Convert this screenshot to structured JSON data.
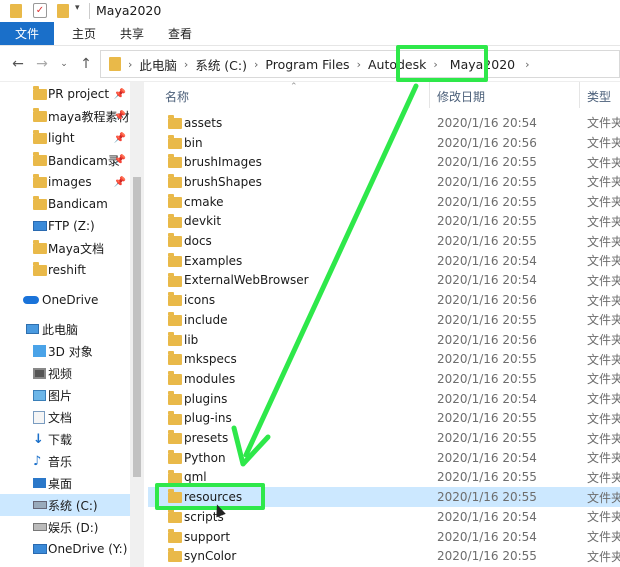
{
  "window": {
    "title": "Maya2020"
  },
  "ribbon": {
    "tabs": [
      "文件",
      "主页",
      "共享",
      "查看"
    ]
  },
  "address": {
    "crumbs": [
      "此电脑",
      "系统 (C:)",
      "Program Files",
      "Autodesk",
      "Maya2020"
    ]
  },
  "sidebar": {
    "quick": [
      {
        "label": "PR project",
        "pin": "📌"
      },
      {
        "label": "maya教程素材",
        "pin": "📌"
      },
      {
        "label": "light",
        "pin": "📌"
      },
      {
        "label": "Bandicam录",
        "pin": "📌"
      },
      {
        "label": "images",
        "pin": "📌"
      },
      {
        "label": "Bandicam"
      },
      {
        "label": "FTP (Z:)"
      },
      {
        "label": "Maya文档"
      },
      {
        "label": "reshift"
      }
    ],
    "onedrive": "OneDrive",
    "thispc": "此电脑",
    "pc_items": [
      "3D 对象",
      "视频",
      "图片",
      "文档",
      "下载",
      "音乐",
      "桌面",
      "系统 (C:)",
      "娱乐 (D:)",
      "OneDrive (Y:)"
    ]
  },
  "columns": {
    "name": "名称",
    "date": "修改日期",
    "type": "类型"
  },
  "files": [
    {
      "name": "assets",
      "date": "2020/1/16 20:54",
      "type": "文件夹"
    },
    {
      "name": "bin",
      "date": "2020/1/16 20:56",
      "type": "文件夹"
    },
    {
      "name": "brushImages",
      "date": "2020/1/16 20:55",
      "type": "文件夹"
    },
    {
      "name": "brushShapes",
      "date": "2020/1/16 20:55",
      "type": "文件夹"
    },
    {
      "name": "cmake",
      "date": "2020/1/16 20:55",
      "type": "文件夹"
    },
    {
      "name": "devkit",
      "date": "2020/1/16 20:55",
      "type": "文件夹"
    },
    {
      "name": "docs",
      "date": "2020/1/16 20:55",
      "type": "文件夹"
    },
    {
      "name": "Examples",
      "date": "2020/1/16 20:54",
      "type": "文件夹"
    },
    {
      "name": "ExternalWebBrowser",
      "date": "2020/1/16 20:54",
      "type": "文件夹"
    },
    {
      "name": "icons",
      "date": "2020/1/16 20:56",
      "type": "文件夹"
    },
    {
      "name": "include",
      "date": "2020/1/16 20:55",
      "type": "文件夹"
    },
    {
      "name": "lib",
      "date": "2020/1/16 20:56",
      "type": "文件夹"
    },
    {
      "name": "mkspecs",
      "date": "2020/1/16 20:55",
      "type": "文件夹"
    },
    {
      "name": "modules",
      "date": "2020/1/16 20:55",
      "type": "文件夹"
    },
    {
      "name": "plugins",
      "date": "2020/1/16 20:54",
      "type": "文件夹"
    },
    {
      "name": "plug-ins",
      "date": "2020/1/16 20:55",
      "type": "文件夹"
    },
    {
      "name": "presets",
      "date": "2020/1/16 20:55",
      "type": "文件夹"
    },
    {
      "name": "Python",
      "date": "2020/1/16 20:54",
      "type": "文件夹"
    },
    {
      "name": "qml",
      "date": "2020/1/16 20:55",
      "type": "文件夹"
    },
    {
      "name": "resources",
      "date": "2020/1/16 20:55",
      "type": "文件夹"
    },
    {
      "name": "scripts",
      "date": "2020/1/16 20:54",
      "type": "文件夹"
    },
    {
      "name": "support",
      "date": "2020/1/16 20:54",
      "type": "文件夹"
    },
    {
      "name": "synColor",
      "date": "2020/1/16 20:55",
      "type": "文件夹"
    }
  ],
  "colors": {
    "accent": "#1a6fc9",
    "highlight": "#2ee84a",
    "selection": "#cce8ff"
  }
}
